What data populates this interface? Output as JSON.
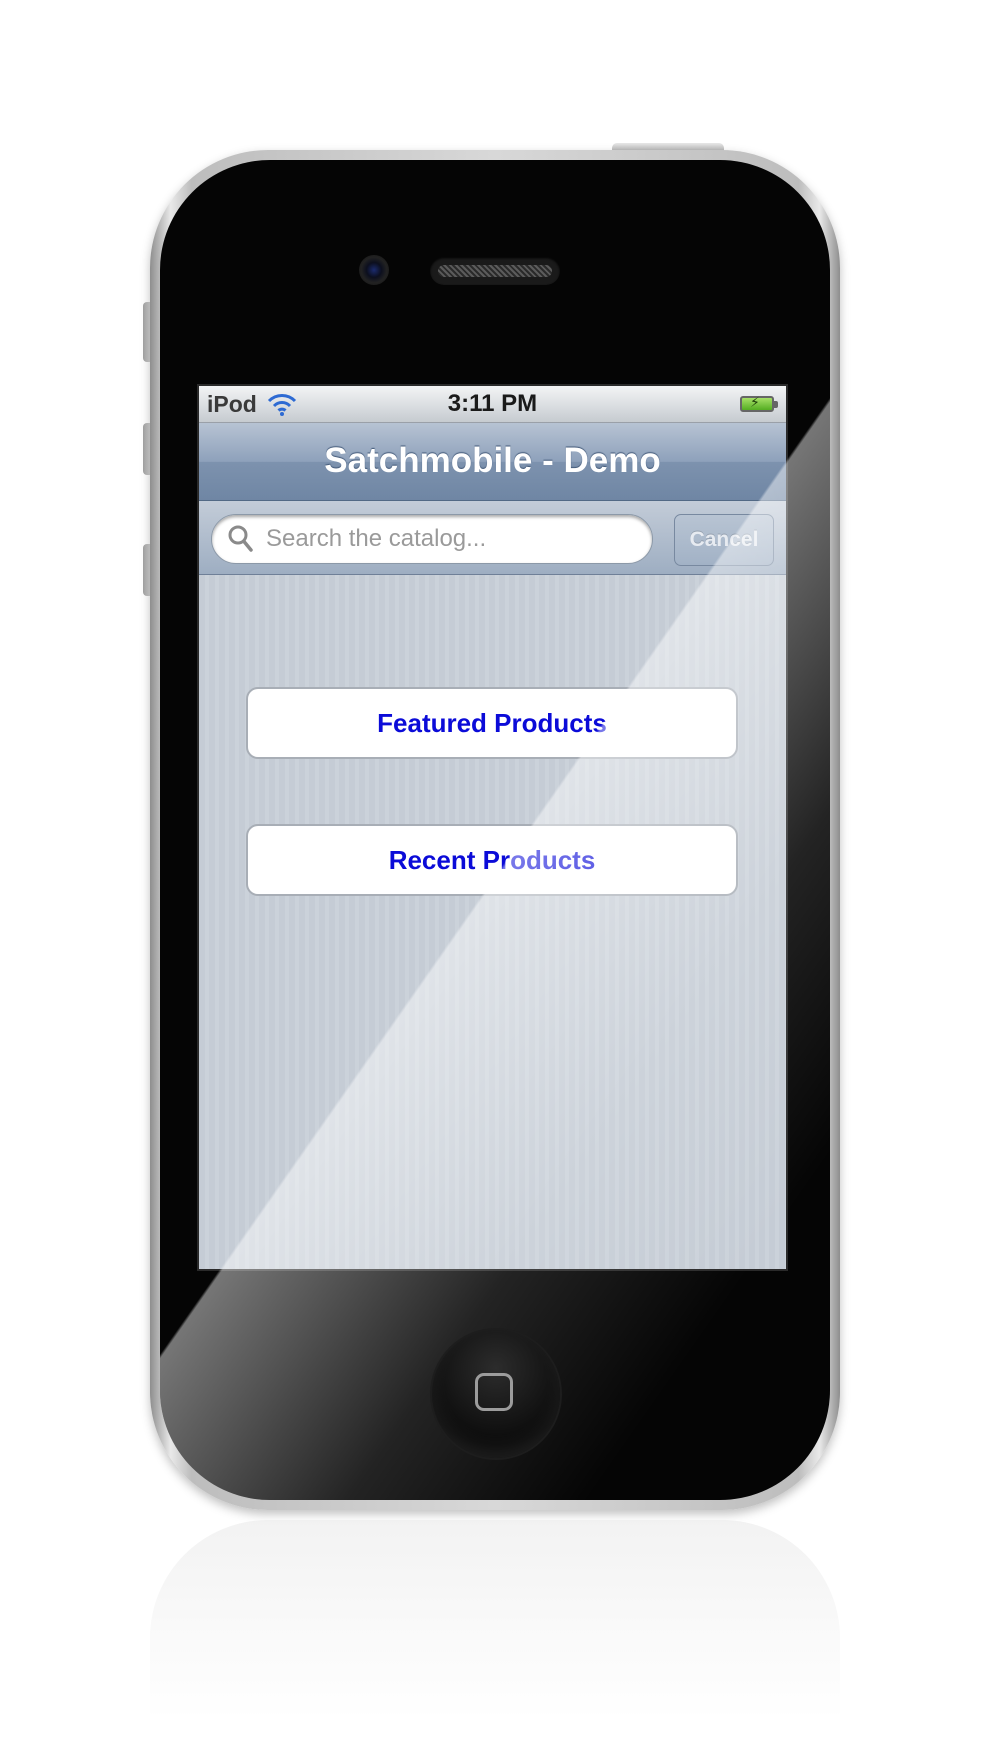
{
  "status_bar": {
    "carrier": "iPod",
    "time": "3:11 PM"
  },
  "nav": {
    "title": "Satchmobile - Demo"
  },
  "search": {
    "placeholder": "Search the catalog...",
    "value": "",
    "cancel_label": "Cancel"
  },
  "menu": {
    "featured_label": "Featured Products",
    "recent_label": "Recent Products"
  },
  "colors": {
    "link_blue": "#0b0bd8",
    "nav_blue": "#7d92ae",
    "background_stripe": "#c5ccd5"
  },
  "icons": {
    "wifi": "wifi-icon",
    "battery": "battery-charging-icon",
    "search": "search-icon",
    "home": "home-button-icon"
  }
}
